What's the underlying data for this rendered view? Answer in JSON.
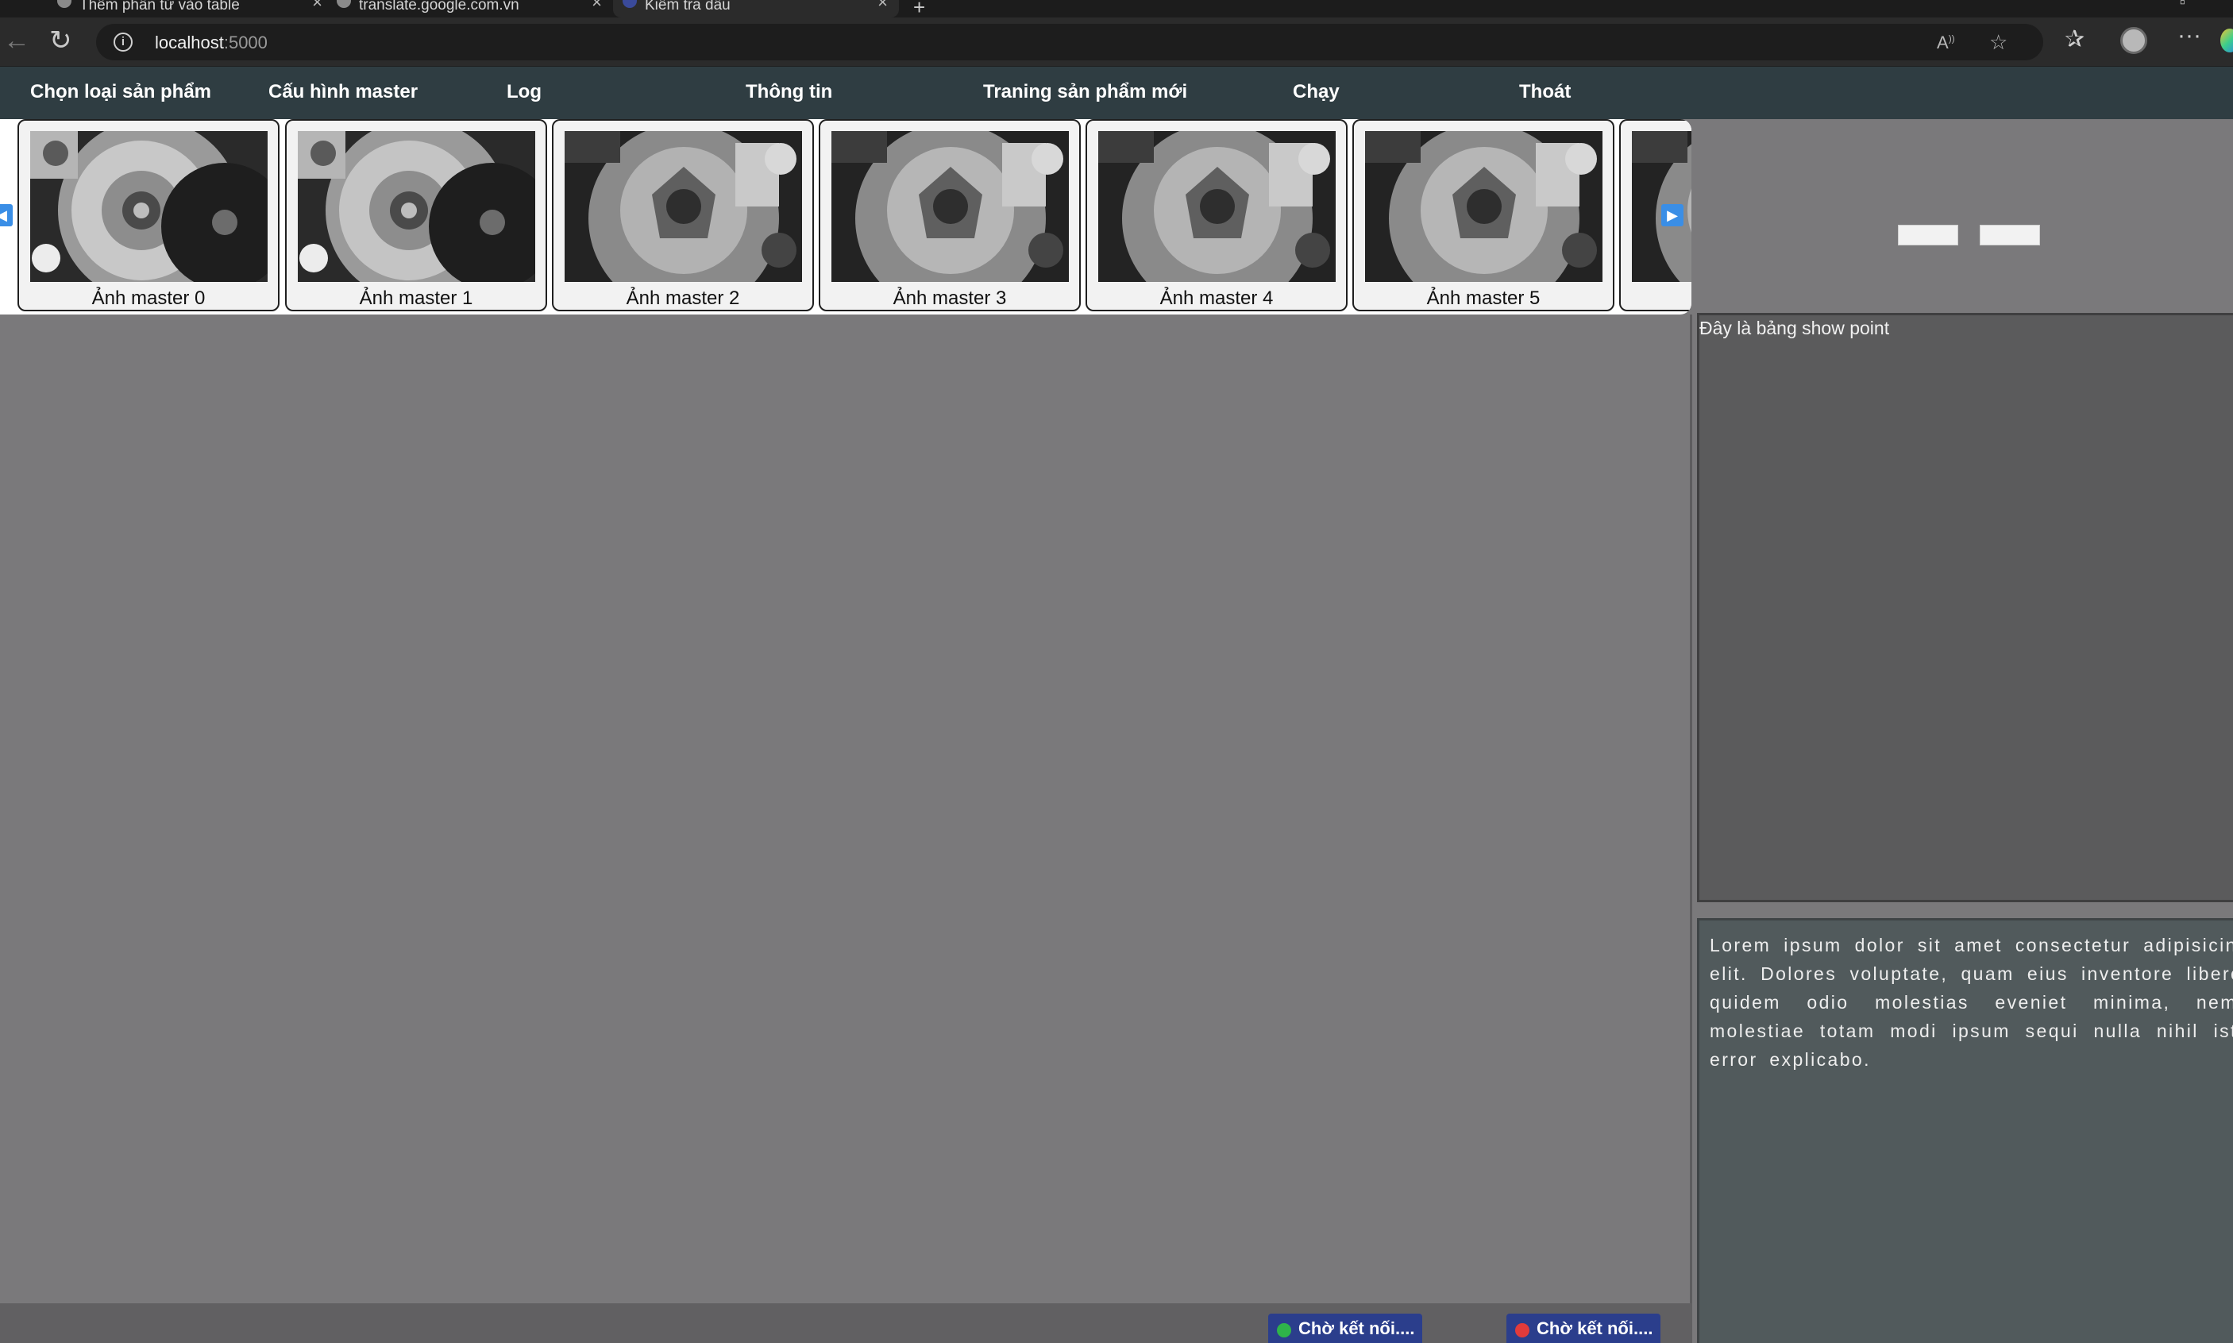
{
  "browser": {
    "tabs": [
      {
        "title": "Thêm phần tử vào table"
      },
      {
        "title": "translate.google.com.vn"
      },
      {
        "title": "Kiểm tra dầu"
      }
    ],
    "url_host": "localhost",
    "url_port": ":5000"
  },
  "menu": {
    "items": [
      {
        "label": "Chọn loại sản phẩm"
      },
      {
        "label": "Cấu hình master"
      },
      {
        "label": "Log"
      },
      {
        "label": "Thông tin"
      },
      {
        "label": "Traning sản phẩm mới"
      },
      {
        "label": "Chạy"
      },
      {
        "label": "Thoát"
      }
    ]
  },
  "thumbnails": [
    {
      "caption": "Ảnh master 0"
    },
    {
      "caption": "Ảnh master 1"
    },
    {
      "caption": "Ảnh master 2"
    },
    {
      "caption": "Ảnh master 3"
    },
    {
      "caption": "Ảnh master 4"
    },
    {
      "caption": "Ảnh master 5"
    }
  ],
  "point_panel": {
    "title": "Đây là bảng show point"
  },
  "info_panel": {
    "text": "Lorem ipsum dolor sit amet consectetur adipisicing elit. Dolores voluptate, quam eius inventore libero, quidem odio molestias eveniet minima, nemo molestiae totam modi ipsum sequi nulla nihil iste error explicabo."
  },
  "status": [
    {
      "label": "Chờ kết nối....",
      "dot_color": "#2fb34a"
    },
    {
      "label": "Chờ kết nối....",
      "dot_color": "#e23b3b"
    }
  ],
  "colors": {
    "menu_bg": "#2f3d42",
    "main_bg": "#7a797b",
    "status_bg": "#2b3e8c",
    "arrow": "#3a8ee6"
  }
}
